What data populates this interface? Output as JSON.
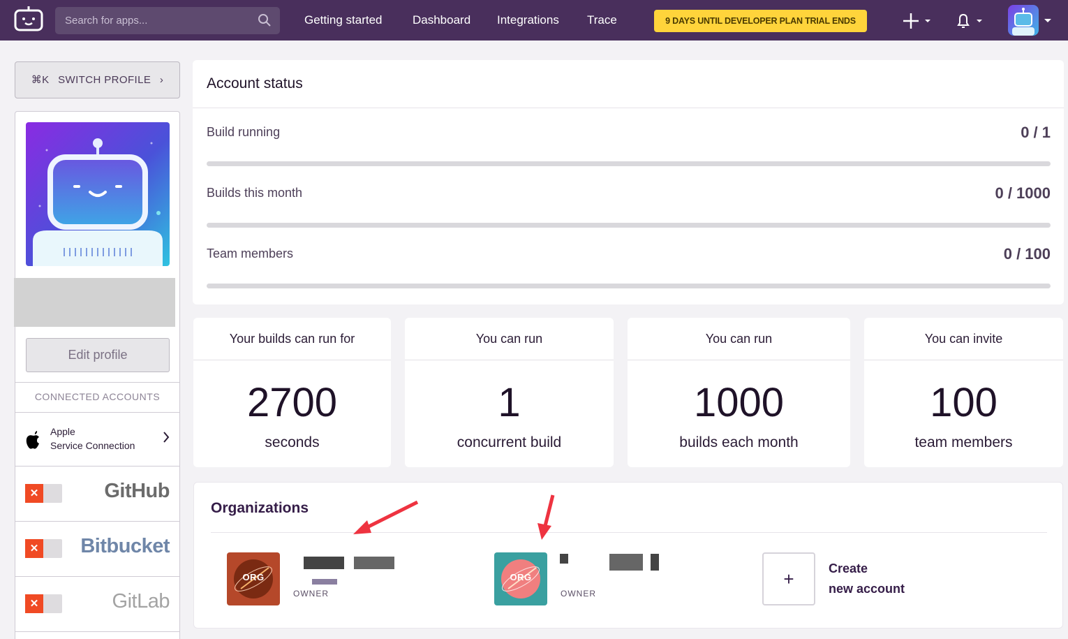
{
  "topbar": {
    "search_placeholder": "Search for apps...",
    "nav": [
      "Getting started",
      "Dashboard",
      "Integrations",
      "Trace"
    ],
    "trial_banner": "9 DAYS UNTIL DEVELOPER PLAN TRIAL ENDS",
    "colors": {
      "bar": "#492f5c",
      "banner": "#ffd43b"
    }
  },
  "sidebar": {
    "switch_shortcut": "⌘K",
    "switch_label": "SWITCH PROFILE",
    "edit_profile": "Edit profile",
    "connected_title": "CONNECTED ACCOUNTS",
    "apple_line1": "Apple",
    "apple_line2": "Service Connection",
    "services": [
      {
        "name": "GitHub",
        "connected": false
      },
      {
        "name": "Bitbucket",
        "connected": false
      },
      {
        "name": "GitLab",
        "connected": false
      }
    ]
  },
  "account_status": {
    "title": "Account status",
    "rows": [
      {
        "label": "Build running",
        "value": "0 / 1",
        "fraction": 0
      },
      {
        "label": "Builds this month",
        "value": "0 / 1000",
        "fraction": 0
      },
      {
        "label": "Team members",
        "value": "0 / 100",
        "fraction": 0
      }
    ]
  },
  "limits": [
    {
      "head": "Your builds can run for",
      "num": "2700",
      "unit": "seconds"
    },
    {
      "head": "You can run",
      "num": "1",
      "unit": "concurrent build"
    },
    {
      "head": "You can run",
      "num": "1000",
      "unit": "builds each month"
    },
    {
      "head": "You can invite",
      "num": "100",
      "unit": "team members"
    }
  ],
  "organizations": {
    "title": "Organizations",
    "items": [
      {
        "logo_text": "ORG",
        "role": "OWNER",
        "color": "#b5482a"
      },
      {
        "logo_text": "ORG",
        "role": "OWNER",
        "color": "#3aa0a0"
      }
    ],
    "create_icon": "+",
    "create_line1": "Create",
    "create_line2": "new account"
  }
}
